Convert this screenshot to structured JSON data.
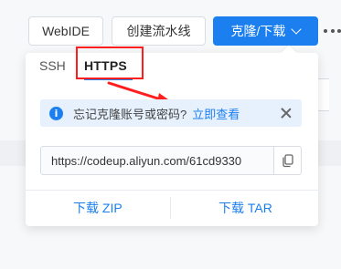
{
  "toolbar": {
    "webide_label": "WebIDE",
    "pipeline_label": "创建流水线",
    "clone_label": "克隆/下载"
  },
  "popover": {
    "tabs": [
      {
        "label": "SSH"
      },
      {
        "label": "HTTPS"
      }
    ],
    "active_tab": "HTTPS",
    "notice": {
      "text": "忘记克隆账号或密码?",
      "link": "立即查看"
    },
    "clone_url": "https://codeup.aliyun.com/61cd9330",
    "downloads": [
      {
        "label": "下载 ZIP"
      },
      {
        "label": "下载 TAR"
      }
    ]
  },
  "colors": {
    "accent": "#1b7ff0",
    "annotation": "#ff1e1e"
  },
  "icons": {
    "more": "more-icon",
    "info": "info-icon",
    "close": "close-icon",
    "copy": "copy-icon",
    "chevron": "chevron-down-icon"
  }
}
